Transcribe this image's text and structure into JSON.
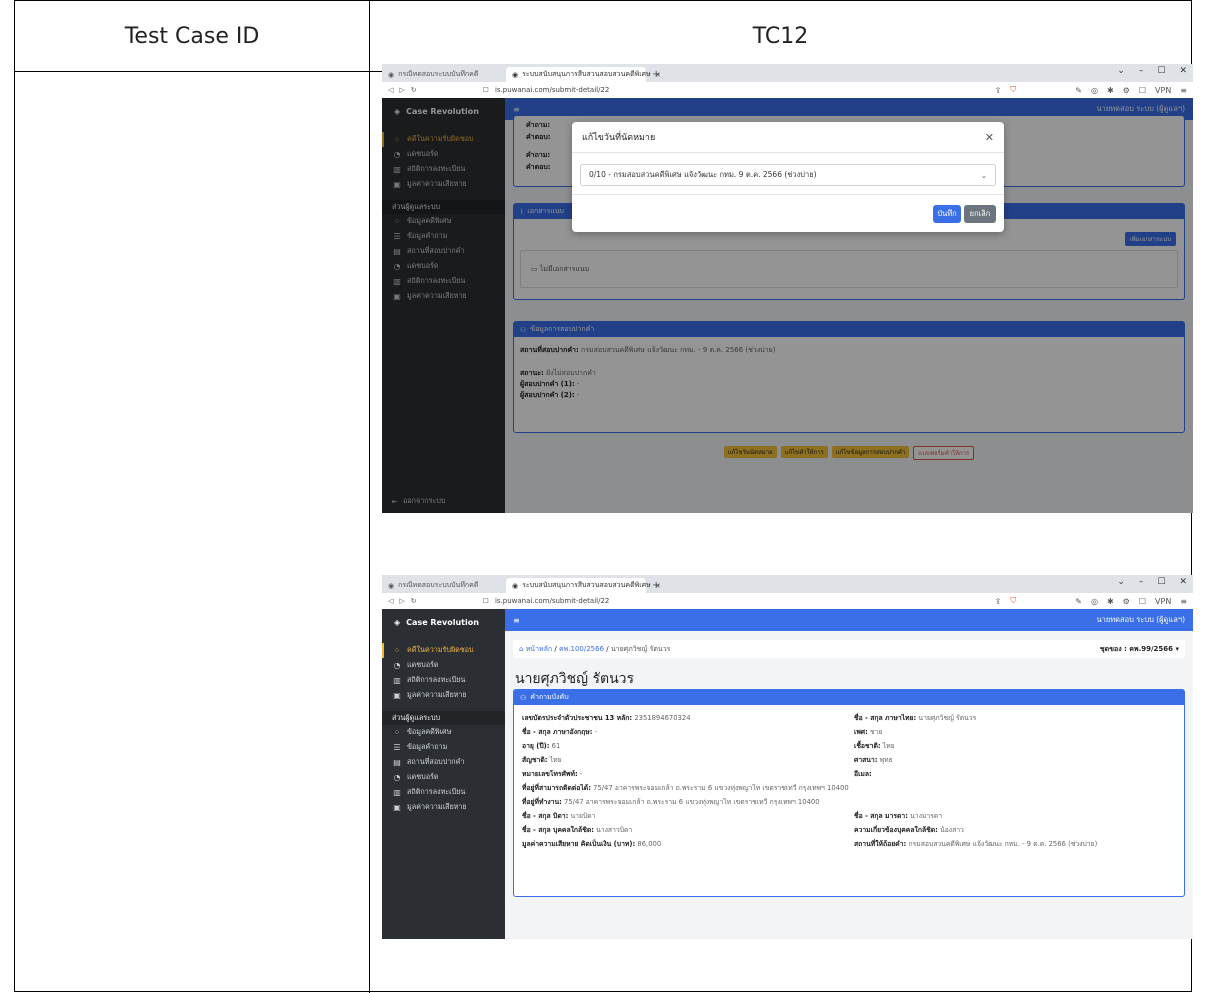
{
  "table": {
    "label_header": "Test Case ID",
    "value_header": "TC12"
  },
  "browser": {
    "inactive_tab": "กรณีทดสอบระบบบันทึกคดี",
    "active_tab": "ระบบสนับสนุนการสืบสวนสอบสวนคดีพิเศษ",
    "url": "is.puwanai.com/submit-detail/22",
    "vpn": "VPN"
  },
  "app": {
    "brand": "Case Revolution",
    "user": "นายทดสอบ ระบบ (ผู้ดูแลฯ)",
    "sidebar": {
      "main_items": [
        "คดีในความรับผิดชอบ",
        "แดชบอร์ด",
        "สถิติการลงทะเบียน",
        "มูลค่าความเสียหาย"
      ],
      "admin_header": "ส่วนผู้ดูแลระบบ",
      "admin_items": [
        "ข้อมูลคดีพิเศษ",
        "ข้อมูลคำถาม",
        "สถานที่สอบปากคำ",
        "แดชบอร์ด",
        "สถิติการลงทะเบียน",
        "มูลค่าความเสียหาย"
      ],
      "logout": "ออกจากระบบ"
    }
  },
  "shot1": {
    "bg_q1": "คำถาม:",
    "bg_a1": "คำตอบ:",
    "bg_q2": "คำถาม:",
    "bg_a2": "คำตอบ:",
    "attach_title": "เอกสารแนบ",
    "attach_add": "เพิ่มเอกสารแนบ",
    "attach_empty": "ไม่มีเอกสารแนบ",
    "interview_title": "ข้อมูลการสอบปากคำ",
    "place_label": "สถานที่สอบปากคำ:",
    "place_value": "กรมสอบสวนคดีพิเศษ แจ้งวัฒนะ กทม. - 9 ต.ค. 2566 (ช่วงบ่าย)",
    "status_label": "สถานะ:",
    "status_value": "ยังไม่สอบปากคำ",
    "interviewer1_label": "ผู้สอบปากคำ (1):",
    "interviewer1_value": "-",
    "interviewer2_label": "ผู้สอบปากคำ (2):",
    "interviewer2_value": "-",
    "actions": [
      "แก้ไขวันนัดหมาย",
      "แก้ไขคำให้การ",
      "แก้ไขข้อมูลการสอบปากคำ",
      "แบบฟอร์มคำให้การ"
    ],
    "modal": {
      "title": "แก้ไขวันที่นัดหมาย",
      "selected": "0/10 - กรมสอบสวนคดีพิเศษ แจ้งวัฒนะ กทม. 9 ต.ค. 2566 (ช่วงบ่าย)",
      "save": "บันทึก",
      "cancel": "ยกเลิก"
    }
  },
  "shot2": {
    "breadcrumb_home": "หน้าหลัก",
    "breadcrumb_case": "คพ.100/2566",
    "breadcrumb_person": "นายศุภวิชญ์ รัตนวร",
    "group_label": "ชุดของ : คพ.99/2566",
    "page_title": "นายศุภวิชญ์ รัตนวร",
    "card_title": "คำถามบังคับ",
    "fields": [
      {
        "k": "เลขบัตรประจำตัวประชาชน 13 หลัก:",
        "v": "2351894670324"
      },
      {
        "k": "ชื่อ - สกุล ภาษาไทย:",
        "v": "นายศุภวิชญ์ รัตนวร"
      },
      {
        "k": "ชื่อ - สกุล ภาษาอังกฤษ:",
        "v": "-"
      },
      {
        "k": "เพศ:",
        "v": "ชาย"
      },
      {
        "k": "อายุ (ปี):",
        "v": "61"
      },
      {
        "k": "เชื้อชาติ:",
        "v": "ไทย"
      },
      {
        "k": "สัญชาติ:",
        "v": "ไทย"
      },
      {
        "k": "ศาสนา:",
        "v": "พุทธ"
      },
      {
        "k": "หมายเลขโทรศัพท์:",
        "v": "-"
      },
      {
        "k": "อีเมล:",
        "v": ""
      }
    ],
    "addr1_k": "ที่อยู่ที่สามารถติดต่อได้:",
    "addr1_v": "75/47 อาคารพระจอมเกล้า ถ.พระราม 6 แขวงทุ่งพญาไท เขตราชเทวี กรุงเทพฯ 10400",
    "addr2_k": "ที่อยู่ที่ทำงาน:",
    "addr2_v": "75/47 อาคารพระจอมเกล้า ถ.พระราม 6 แขวงทุ่งพญาไท เขตราชเทวี กรุงเทพฯ 10400",
    "fields2": [
      {
        "k": "ชื่อ - สกุล บิดา:",
        "v": "นายบิดา"
      },
      {
        "k": "ชื่อ - สกุล มารดา:",
        "v": "นางมารดา"
      },
      {
        "k": "ชื่อ - สกุล บุคคลใกล้ชิด:",
        "v": "นางสาวบิดา"
      },
      {
        "k": "ความเกี่ยวข้องบุคคลใกล้ชิด:",
        "v": "น้องสาว"
      },
      {
        "k": "มูลค่าความเสียหาย คิดเป็นเงิน (บาท):",
        "v": "86,000"
      },
      {
        "k": "สถานที่ให้ถ้อยคำ:",
        "v": "กรมสอบสวนคดีพิเศษ แจ้งวัฒนะ กทม. - 9 ต.ค. 2566 (ช่วงบ่าย)"
      }
    ]
  }
}
